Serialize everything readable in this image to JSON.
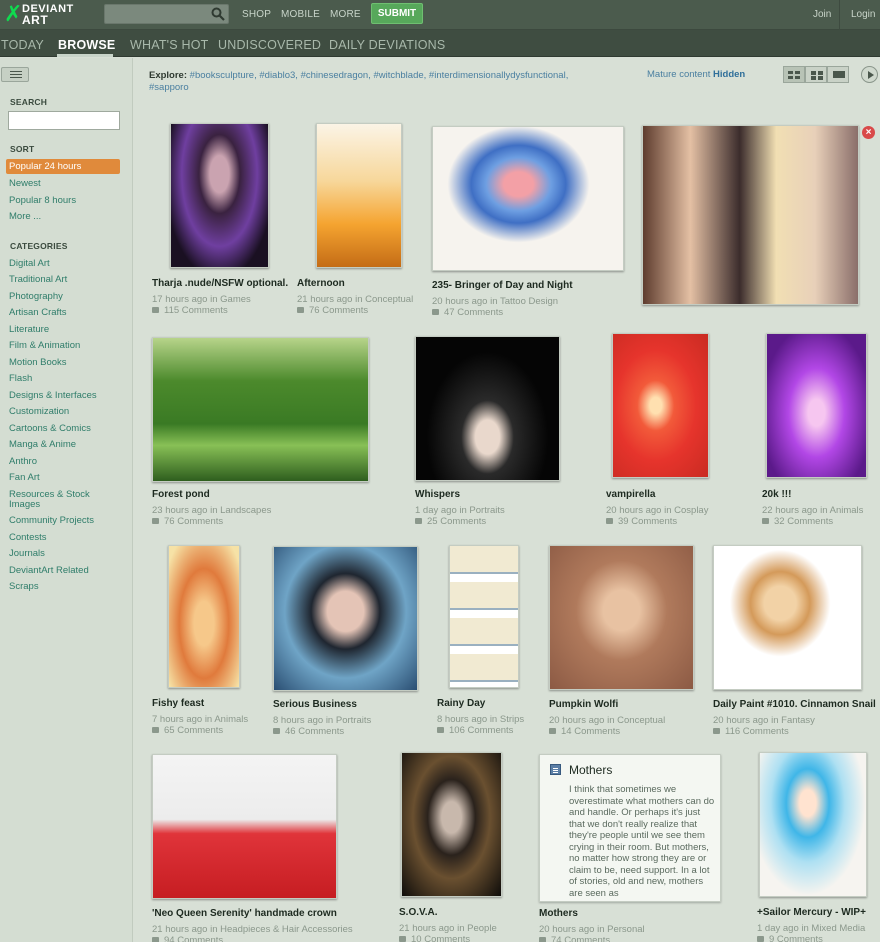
{
  "header": {
    "logo_line1": "DEVIANT",
    "logo_line2": "ART",
    "search_placeholder": "",
    "nav": [
      "SHOP",
      "MOBILE",
      "MORE"
    ],
    "submit_label": "SUBMIT",
    "join_label": "Join",
    "login_label": "Login"
  },
  "tabs": [
    {
      "label": "TODAY",
      "active": false
    },
    {
      "label": "BROWSE",
      "active": true
    },
    {
      "label": "WHAT'S HOT",
      "active": false
    },
    {
      "label": "UNDISCOVERED",
      "active": false
    },
    {
      "label": "DAILY DEVIATIONS",
      "active": false
    }
  ],
  "sidebar": {
    "search_heading": "SEARCH",
    "sort_heading": "SORT",
    "sort_items": [
      "Popular 24 hours",
      "Newest",
      "Popular 8 hours",
      "More ..."
    ],
    "categories_heading": "CATEGORIES",
    "categories": [
      "Digital Art",
      "Traditional Art",
      "Photography",
      "Artisan Crafts",
      "Literature",
      "Film & Animation",
      "Motion Books",
      "Flash",
      "Designs & Interfaces",
      "Customization",
      "Cartoons & Comics",
      "Manga & Anime",
      "Anthro",
      "Fan Art",
      "Resources & Stock",
      "Images",
      "Community Projects",
      "Contests",
      "Journals",
      "DeviantArt Related",
      "Scraps"
    ]
  },
  "explore": {
    "label": "Explore:",
    "tags": [
      "#booksculpture,",
      "#diablo3,",
      "#chinesedragon,",
      "#witchblade,",
      "#interdimensionallydysfunctional,",
      "#sapporo"
    ]
  },
  "mature": {
    "label": "Mature content",
    "value": "Hidden"
  },
  "deviations": [
    {
      "title": "Tharja .nude/NSFW optional.",
      "time": "17 hours ago in",
      "category": "Games",
      "comments": "115 Comments"
    },
    {
      "title": "Afternoon",
      "time": "21 hours ago in",
      "category": "Conceptual",
      "comments": "76 Comments"
    },
    {
      "title": "235- Bringer of Day and Night",
      "time": "20 hours ago in",
      "category": "Tattoo Design",
      "comments": "47 Comments"
    },
    {
      "title": "Forest pond",
      "time": "23 hours ago in",
      "category": "Landscapes",
      "comments": "76 Comments"
    },
    {
      "title": "Whispers",
      "time": "1 day ago in",
      "category": "Portraits",
      "comments": "25 Comments"
    },
    {
      "title": "vampirella",
      "time": "20 hours ago in",
      "category": "Cosplay",
      "comments": "39 Comments"
    },
    {
      "title": "20k !!!",
      "time": "22 hours ago in",
      "category": "Animals",
      "comments": "32 Comments"
    },
    {
      "title": "Fishy feast",
      "time": "7 hours ago in",
      "category": "Animals",
      "comments": "65 Comments"
    },
    {
      "title": "Serious Business",
      "time": "8 hours ago in",
      "category": "Portraits",
      "comments": "46 Comments"
    },
    {
      "title": "Rainy Day",
      "time": "8 hours ago in",
      "category": "Strips",
      "comments": "106 Comments"
    },
    {
      "title": "Pumpkin Wolfi",
      "time": "20 hours ago in",
      "category": "Conceptual",
      "comments": "14 Comments"
    },
    {
      "title": "Daily Paint #1010. Cinnamon Snail",
      "time": "20 hours ago in",
      "category": "Fantasy",
      "comments": "116 Comments"
    },
    {
      "title": "'Neo Queen Serenity' handmade crown",
      "time": "21 hours ago in",
      "category": "Headpieces & Hair Accessories",
      "comments": "94 Comments"
    },
    {
      "title": "S.O.V.A.",
      "time": "21 hours ago in",
      "category": "People",
      "comments": "10 Comments"
    },
    {
      "title": "Mothers",
      "time": "20 hours ago in",
      "category": "Personal",
      "comments": "74 Comments"
    },
    {
      "title": "+Sailor Mercury - WIP+",
      "time": "1 day ago in",
      "category": "Mixed Media",
      "comments": "9 Comments"
    }
  ],
  "literature": {
    "title": "Mothers",
    "body": "I think that sometimes we overestimate what mothers can do and handle. Or perhaps it's just that we don't really realize that they're people until we see them crying in their room. But mothers, no matter how strong they are or claim to be, need support. In a lot of stories, old and new, mothers are seen as"
  },
  "colors": {
    "accent_green": "#57a85b",
    "sort_active": "#e08a3b",
    "link": "#2f7d6a",
    "background": "#d8e0d6"
  }
}
